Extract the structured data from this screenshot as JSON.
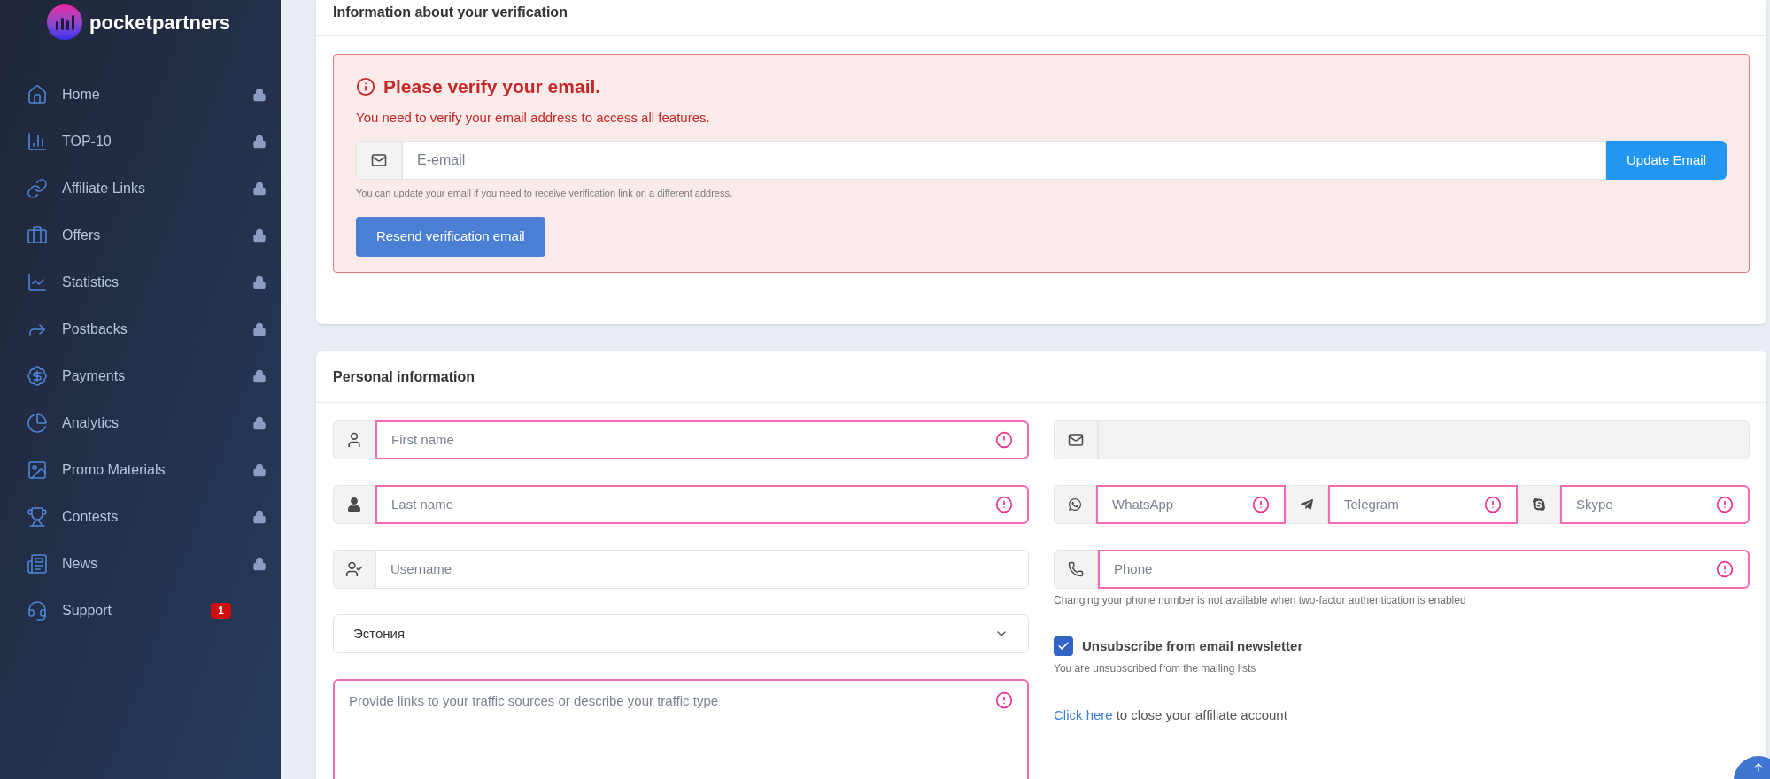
{
  "brand": {
    "name": "pocketpartners"
  },
  "sidebar": {
    "items": [
      {
        "label": "Home",
        "locked": true
      },
      {
        "label": "TOP-10",
        "locked": true
      },
      {
        "label": "Affiliate Links",
        "locked": true
      },
      {
        "label": "Offers",
        "locked": true
      },
      {
        "label": "Statistics",
        "locked": true
      },
      {
        "label": "Postbacks",
        "locked": true
      },
      {
        "label": "Payments",
        "locked": true
      },
      {
        "label": "Analytics",
        "locked": true
      },
      {
        "label": "Promo Materials",
        "locked": true
      },
      {
        "label": "Contests",
        "locked": true
      },
      {
        "label": "News",
        "locked": true
      },
      {
        "label": "Support",
        "locked": false,
        "badge": "1"
      }
    ]
  },
  "verification": {
    "title": "Information about your verification",
    "alert_title": "Please verify your email.",
    "alert_text": "You need to verify your email address to access all features.",
    "email_placeholder": "E-email",
    "update_button": "Update Email",
    "hint": "You can update your email if you need to receive verification link on a different address.",
    "resend_button": "Resend verification email"
  },
  "personal": {
    "title": "Personal information",
    "left_fields": [
      {
        "placeholder": "First name",
        "invalid": true
      },
      {
        "placeholder": "Last name",
        "invalid": true
      },
      {
        "placeholder": "Username",
        "invalid": false
      }
    ],
    "country": "Эстония",
    "traffic": {
      "placeholder": "Provide links to your traffic sources or describe your traffic type",
      "invalid": true
    },
    "email": {
      "disabled": true
    },
    "messengers": [
      {
        "placeholder": "WhatsApp",
        "invalid": true
      },
      {
        "placeholder": "Telegram",
        "invalid": true
      },
      {
        "placeholder": "Skype",
        "invalid": true
      }
    ],
    "phone": {
      "placeholder": "Phone",
      "invalid": true
    },
    "phone_hint": "Changing your phone number is not available when two-factor authentication is enabled",
    "newsletter": {
      "label": "Unsubscribe from email newsletter",
      "checked": true,
      "hint": "You are unsubscribed from the mailing lists"
    },
    "close_account": {
      "link": "Click here",
      "text": "to close your affiliate account"
    }
  }
}
